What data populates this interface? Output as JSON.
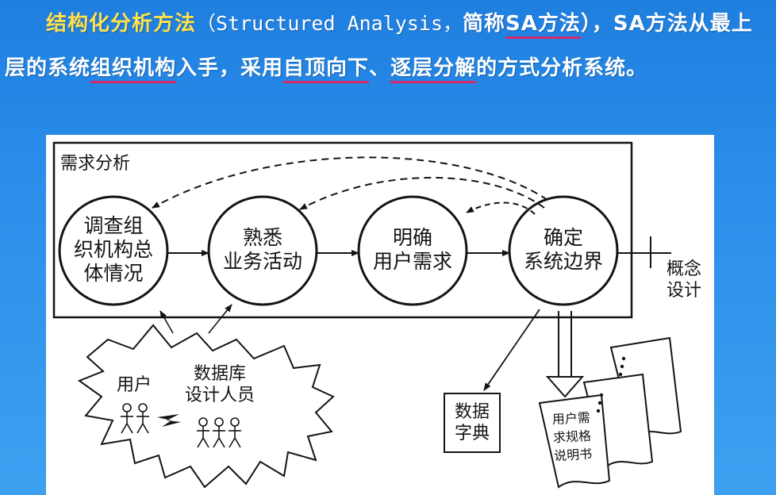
{
  "intro": {
    "title": "结构化分析方法",
    "full_name": "（Structured Analysis，",
    "abbrev_prefix": "简称",
    "abbrev": "SA方法",
    "close": "），SA",
    "line2_start": "方法从最上层的系统",
    "underline_1": "组织机构",
    "line2_mid": "入手，采用",
    "underline_2": "自顶向下",
    "sep": "、",
    "underline_3": "逐层分解",
    "line2_end": "的方式分析系统。"
  },
  "diagram": {
    "region_label": "需求分析",
    "nodes": [
      "调查组\n织机构总\n体情况",
      "熟悉\n业务活动",
      "明确\n用户需求",
      "确定\n系统边界"
    ],
    "output_label": "概念\n设计",
    "cloud": {
      "users_label": "用户",
      "designers_label": "数据库\n设计人员"
    },
    "data_dictionary_label": "数据\n字典",
    "spec_doc_label": "用户需\n求规格\n说明书"
  },
  "colors": {
    "background": "#2b8fea",
    "highlight_text": "#ffe14d",
    "underline": "#d22a6a",
    "figure_background": "#ffffff",
    "ink": "#141414"
  }
}
